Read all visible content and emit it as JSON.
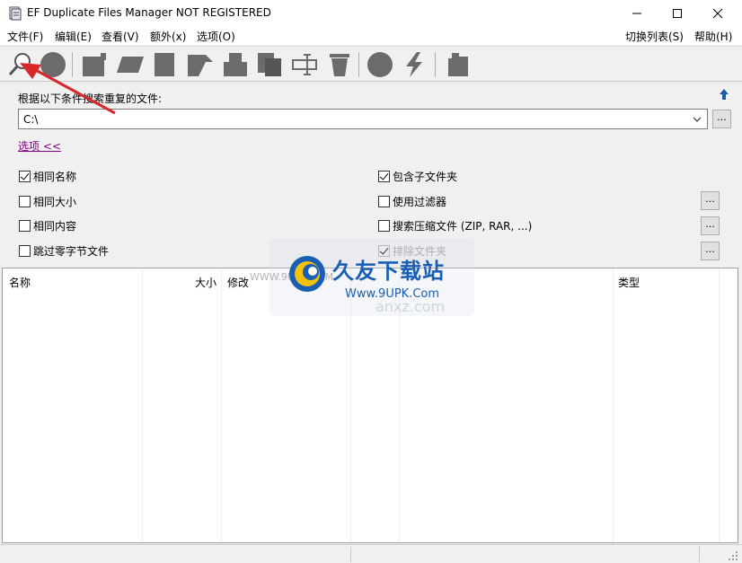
{
  "window": {
    "title": "EF Duplicate Files Manager NOT REGISTERED",
    "minimize_glyph": "—",
    "maximize_glyph": "☐",
    "close_glyph": "✕"
  },
  "menu": {
    "left": [
      "文件(F)",
      "编辑(E)",
      "查看(V)",
      "额外(x)",
      "选项(O)"
    ],
    "right": [
      "切换列表(S)",
      "帮助(H)"
    ]
  },
  "toolbar": {
    "icons": [
      "search-icon",
      "stop-icon",
      "select-icon",
      "tag-icon",
      "document-icon",
      "move-icon",
      "copy-folder-icon",
      "copy-icon",
      "rename-icon",
      "delete-icon",
      "settings-icon",
      "flash-icon",
      "export-icon"
    ]
  },
  "search": {
    "label": "根据以下条件搜索重复的文件:",
    "path": "C:\\",
    "browse": "...",
    "options_link": "选项 <<"
  },
  "options": {
    "same_name": "相同名称",
    "same_size": "相同大小",
    "same_content": "相同内容",
    "skip_zero": "跳过零字节文件",
    "include_subfolders": "包含子文件夹",
    "use_filter": "使用过滤器",
    "search_archives": "搜索压缩文件 (ZIP, RAR, ...)",
    "exclude_folders": "排除文件夹"
  },
  "list": {
    "columns": [
      "名称",
      "大小",
      "修改",
      "类型"
    ]
  },
  "watermark": {
    "title": "久友下载站",
    "url": "Www.9UPK.Com",
    "faint_url": "WWW.9UPK.COM",
    "faint_brand": "anxz.com"
  },
  "colors": {
    "link": "#800080",
    "arrow": "#d9262a",
    "watermark": "#1a5fb4"
  }
}
